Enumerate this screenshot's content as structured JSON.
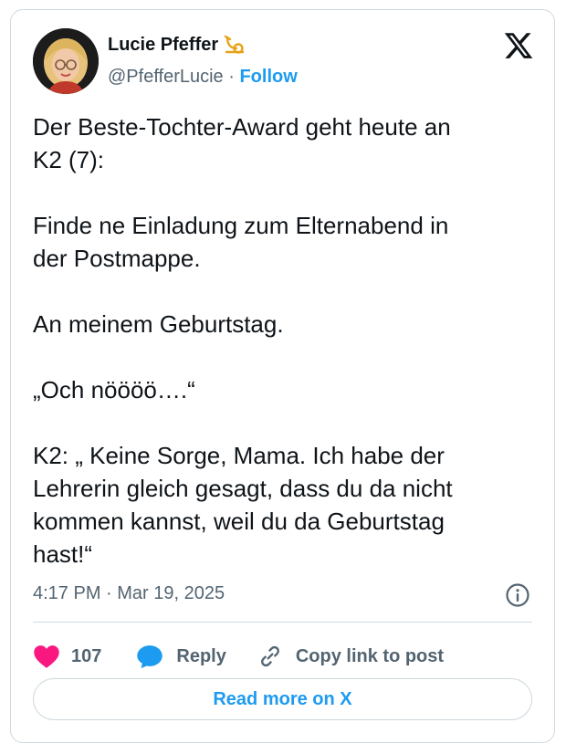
{
  "author": {
    "name": "Lucie Pfeffer",
    "handle": "@PfefferLucie",
    "separator": "·",
    "follow_label": "Follow",
    "badge_icon": "post-horn-icon"
  },
  "platform_icon": "x-logo-icon",
  "tweet": {
    "text": "Der Beste-Tochter-Award geht heute an\nK2 (7):\n\nFinde ne Einladung zum Elternabend in\nder Postmappe.\n\nAn meinem Geburtstag.\n\n„Och nöööö….“\n\nK2: „ Keine Sorge, Mama. Ich habe der\nLehrerin gleich gesagt, dass du da nicht\nkommen kannst, weil du da Geburtstag\nhast!“",
    "timestamp": "4:17 PM · Mar 19, 2025"
  },
  "actions": {
    "like_count": "107",
    "reply_label": "Reply",
    "copy_label": "Copy link to post"
  },
  "read_more_label": "Read more on X",
  "colors": {
    "accent": "#1d9bf0",
    "like": "#f91880",
    "text": "#0f1419",
    "secondary": "#536471",
    "border": "#cfd9de"
  }
}
